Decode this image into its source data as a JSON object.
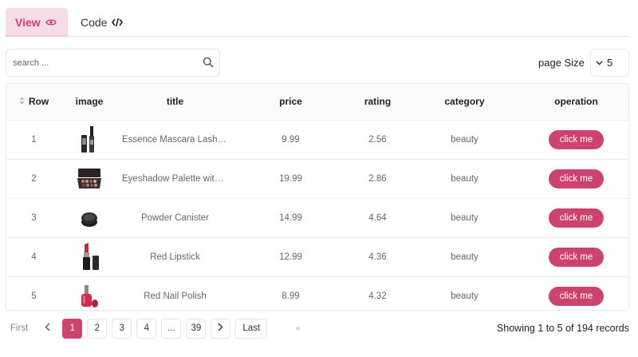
{
  "tabs": {
    "view_label": "View",
    "code_label": "Code"
  },
  "search": {
    "placeholder": "search ...",
    "value": ""
  },
  "page_size": {
    "label": "page Size",
    "value": "5"
  },
  "table": {
    "headers": {
      "row": "Row",
      "image": "image",
      "title": "title",
      "price": "price",
      "rating": "rating",
      "category": "category",
      "operation": "operation"
    },
    "rows": [
      {
        "row": "1",
        "title": "Essence Mascara Lash Pri...",
        "price": "9.99",
        "rating": "2.56",
        "category": "beauty",
        "action": "click me",
        "image_icon": "mascara-icon"
      },
      {
        "row": "2",
        "title": "Eyeshadow Palette with ...",
        "price": "19.99",
        "rating": "2.86",
        "category": "beauty",
        "action": "click me",
        "image_icon": "eyeshadow-palette-icon"
      },
      {
        "row": "3",
        "title": "Powder Canister",
        "price": "14.99",
        "rating": "4.64",
        "category": "beauty",
        "action": "click me",
        "image_icon": "powder-canister-icon"
      },
      {
        "row": "4",
        "title": "Red Lipstick",
        "price": "12.99",
        "rating": "4.36",
        "category": "beauty",
        "action": "click me",
        "image_icon": "lipstick-icon"
      },
      {
        "row": "5",
        "title": "Red Nail Polish",
        "price": "8.99",
        "rating": "4.32",
        "category": "beauty",
        "action": "click me",
        "image_icon": "nail-polish-icon"
      }
    ]
  },
  "pagination": {
    "first": "First",
    "pages": [
      "1",
      "2",
      "3",
      "4",
      "...",
      "39"
    ],
    "current": "1",
    "last": "Last"
  },
  "records_text": "Showing 1 to 5 of 194 records",
  "colors": {
    "accent": "#cc4370",
    "tab_active_bg": "#f6dce6",
    "tab_active_text": "#c6406d"
  }
}
